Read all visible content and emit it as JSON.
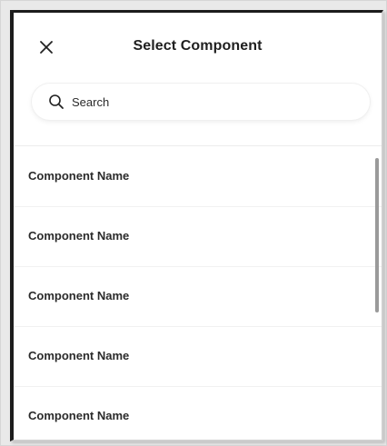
{
  "dialog": {
    "title": "Select Component",
    "close_icon": "close-icon"
  },
  "search": {
    "placeholder": "Search",
    "value": "",
    "icon": "search-icon"
  },
  "list": {
    "items": [
      {
        "label": "Component Name"
      },
      {
        "label": "Component Name"
      },
      {
        "label": "Component Name"
      },
      {
        "label": "Component Name"
      },
      {
        "label": "Component Name"
      }
    ]
  }
}
